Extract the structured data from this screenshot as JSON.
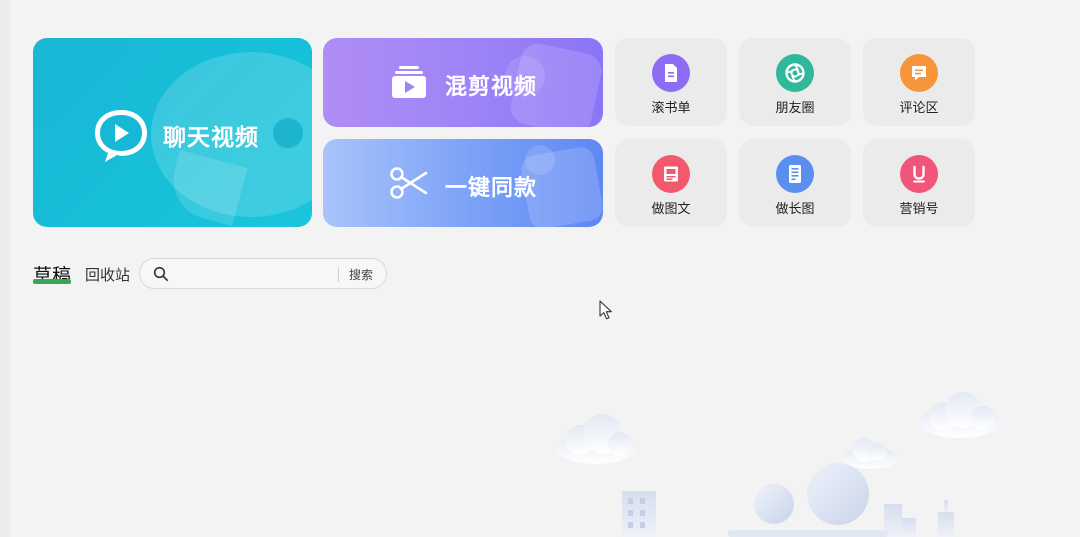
{
  "cards": {
    "chat": {
      "label": "聊天视频",
      "color": "#19b6d6"
    },
    "mix": {
      "label": "混剪视频",
      "color": "#9d83f7"
    },
    "one_click": {
      "label": "一键同款",
      "color": "#7aa0f7"
    }
  },
  "tools": [
    {
      "label": "滚书单",
      "icon": "document-icon",
      "color": "#8c6cf3"
    },
    {
      "label": "朋友圈",
      "icon": "aperture-icon",
      "color": "#2fb89a"
    },
    {
      "label": "评论区",
      "icon": "comment-icon",
      "color": "#f7953a"
    },
    {
      "label": "做图文",
      "icon": "image-text-icon",
      "color": "#f25a6b"
    },
    {
      "label": "做长图",
      "icon": "long-image-icon",
      "color": "#5a8fef"
    },
    {
      "label": "营销号",
      "icon": "u-icon",
      "color": "#f2557a"
    }
  ],
  "tabs": {
    "drafts": "草稿",
    "recycle_bin": "回收站",
    "active_underline_color": "#3aa757"
  },
  "search": {
    "value": "",
    "button_label": "搜索"
  }
}
